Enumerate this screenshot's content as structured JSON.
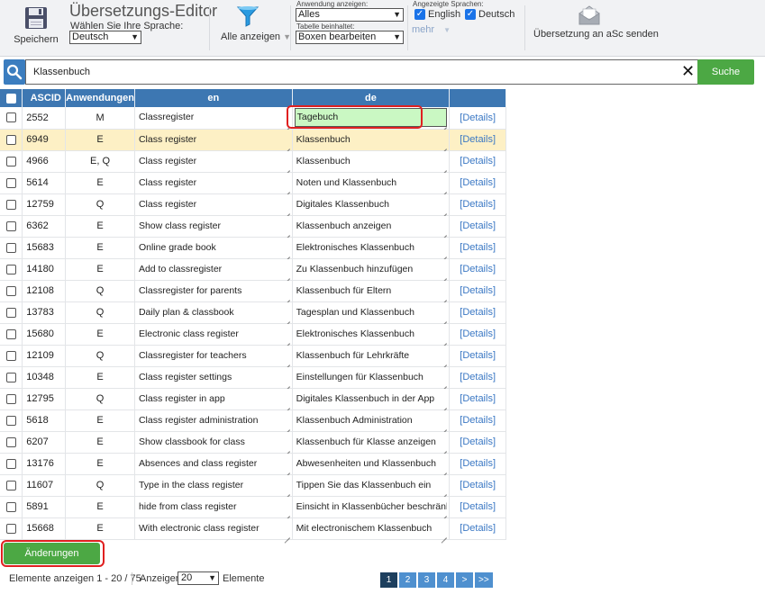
{
  "toolbar": {
    "save_label": "Speichern",
    "title": "Übersetzungs-Editor",
    "language_label": "Wählen Sie Ihre Sprache:",
    "language_value": "Deutsch",
    "filter_label": "Alle anzeigen",
    "app_show_label": "Anwendung anzeigen:",
    "app_show_value": "Alles",
    "table_contains_label": "Tabelle beinhaltet:",
    "table_contains_value": "Boxen bearbeiten",
    "shown_languages_label": "Angezeigte Sprachen:",
    "lang_en": "English",
    "lang_de": "Deutsch",
    "more_label": "mehr",
    "send_label": "Übersetzung an aSc senden"
  },
  "search": {
    "value": "Klassenbuch",
    "button_label": "Suche"
  },
  "table": {
    "headers": {
      "ascid": "ASCID",
      "apps": "Anwendungen",
      "en": "en",
      "de": "de"
    },
    "details_label": "[Details]",
    "rows": [
      {
        "id": "2552",
        "app": "M",
        "en": "Classregister",
        "de": "Tagebuch"
      },
      {
        "id": "6949",
        "app": "E",
        "en": "Class register",
        "de": "Klassenbuch"
      },
      {
        "id": "4966",
        "app": "E, Q",
        "en": "Class register",
        "de": "Klassenbuch"
      },
      {
        "id": "5614",
        "app": "E",
        "en": "Class register",
        "de": "Noten und Klassenbuch"
      },
      {
        "id": "12759",
        "app": "Q",
        "en": "Class register",
        "de": "Digitales Klassenbuch"
      },
      {
        "id": "6362",
        "app": "E",
        "en": "Show class register",
        "de": "Klassenbuch anzeigen"
      },
      {
        "id": "15683",
        "app": "E",
        "en": "Online grade book",
        "de": "Elektronisches Klassenbuch"
      },
      {
        "id": "14180",
        "app": "E",
        "en": "Add to classregister",
        "de": "Zu Klassenbuch hinzufügen"
      },
      {
        "id": "12108",
        "app": "Q",
        "en": "Classregister for parents",
        "de": "Klassenbuch für Eltern"
      },
      {
        "id": "13783",
        "app": "Q",
        "en": "Daily plan & classbook",
        "de": "Tagesplan und Klassenbuch"
      },
      {
        "id": "15680",
        "app": "E",
        "en": "Electronic class register",
        "de": "Elektronisches Klassenbuch"
      },
      {
        "id": "12109",
        "app": "Q",
        "en": "Classregister for teachers",
        "de": "Klassenbuch für Lehrkräfte"
      },
      {
        "id": "10348",
        "app": "E",
        "en": "Class register settings",
        "de": "Einstellungen für Klassenbuch"
      },
      {
        "id": "12795",
        "app": "Q",
        "en": "Class register in app",
        "de": "Digitales Klassenbuch in der App"
      },
      {
        "id": "5618",
        "app": "E",
        "en": "Class register administration",
        "de": "Klassenbuch Administration"
      },
      {
        "id": "6207",
        "app": "E",
        "en": "Show classbook for class",
        "de": "Klassenbuch für Klasse anzeigen"
      },
      {
        "id": "13176",
        "app": "E",
        "en": "Absences and class register",
        "de": "Abwesenheiten und Klassenbuch"
      },
      {
        "id": "11607",
        "app": "Q",
        "en": "Type in the class register",
        "de": "Tippen Sie das Klassenbuch ein"
      },
      {
        "id": "5891",
        "app": "E",
        "en": "hide from class register",
        "de": "Einsicht in Klassenbücher beschränkt"
      },
      {
        "id": "15668",
        "app": "E",
        "en": "With electronic class register",
        "de": "Mit electronischem Klassenbuch"
      }
    ]
  },
  "footer": {
    "save_changes_label": "Änderungen speichern",
    "range_text": "Elemente anzeigen 1 - 20 / 75",
    "show_label": "Anzeigen:",
    "page_size_value": "20",
    "unit_label": "Elemente",
    "pages": [
      "1",
      "2",
      "3",
      "4",
      ">",
      ">>"
    ]
  },
  "colors": {
    "header_blue": "#3d77b2",
    "accent_green": "#4ca844",
    "highlight_row": "#fdf0c5",
    "editing_cell": "#caf8c3",
    "annotation_red": "#e02020"
  }
}
